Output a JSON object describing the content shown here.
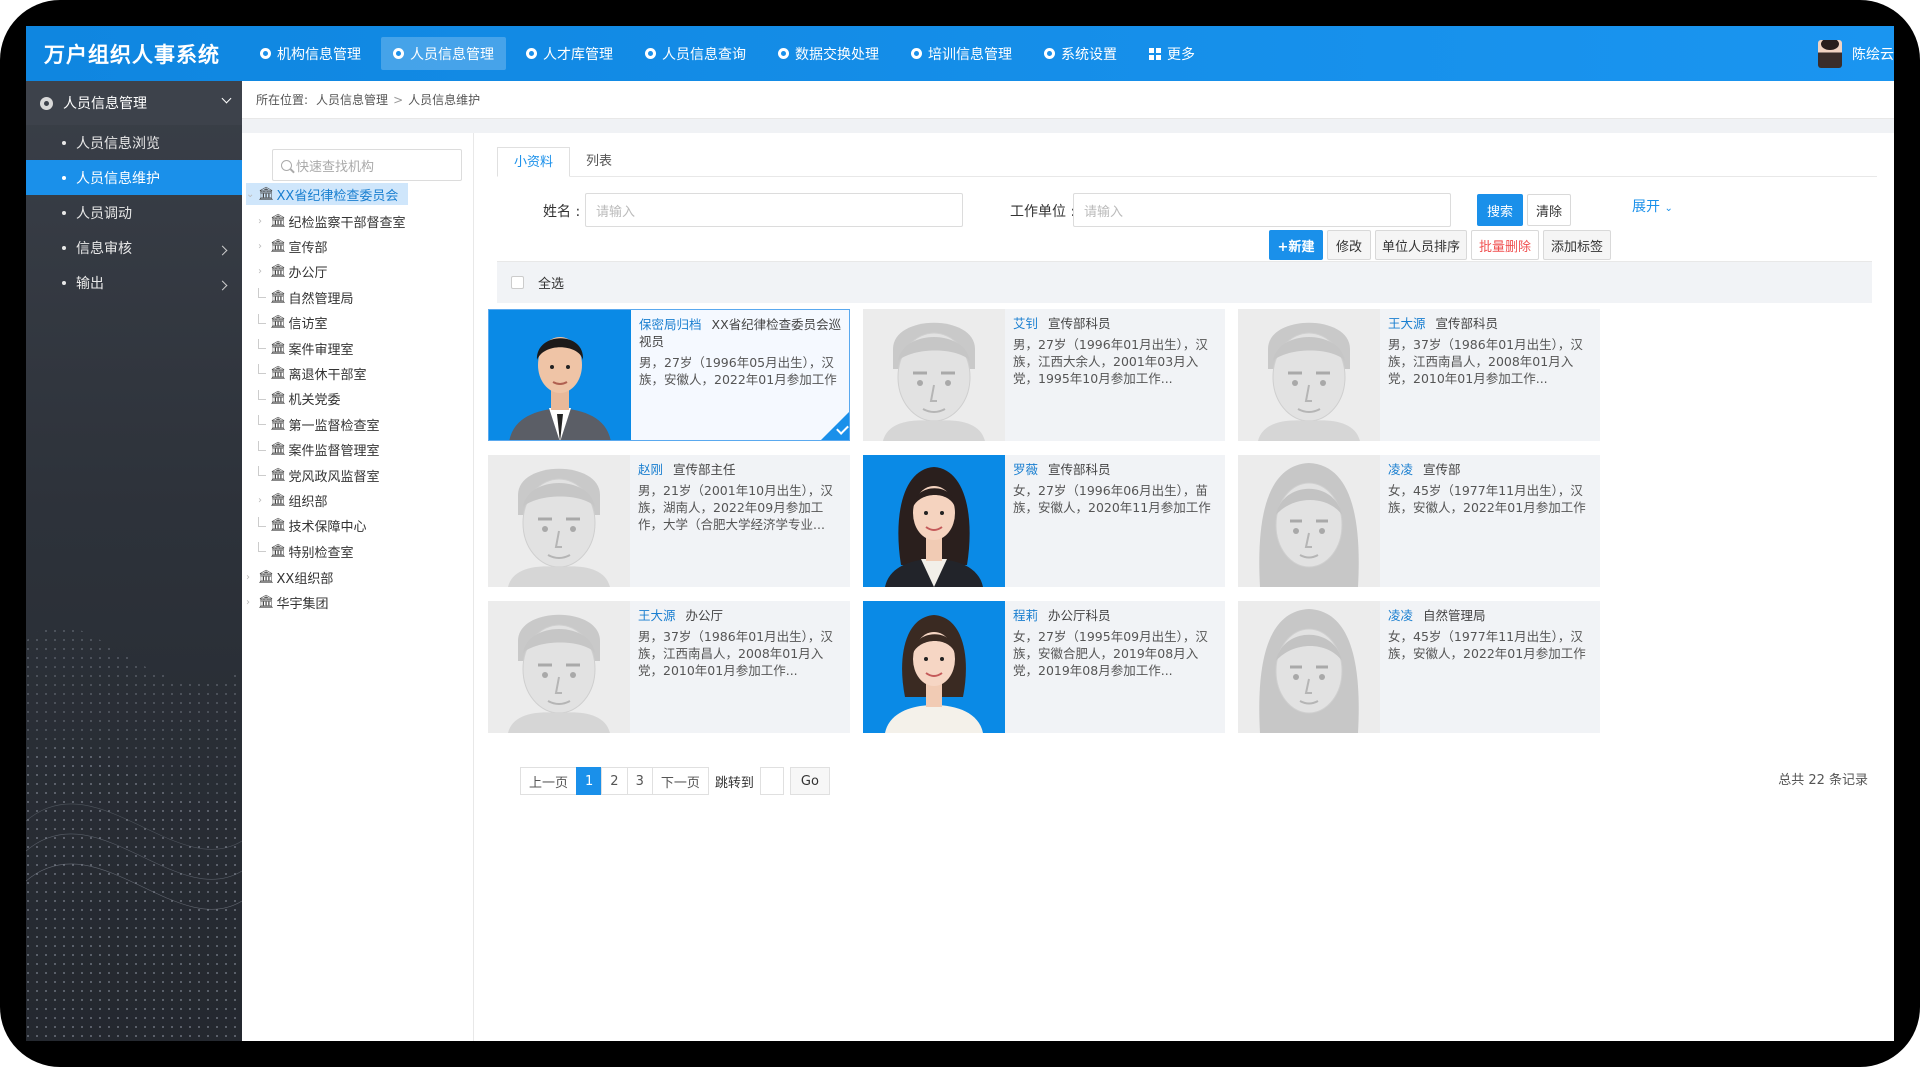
{
  "app": {
    "title": "万户组织人事系统"
  },
  "nav": [
    {
      "label": "机构信息管理",
      "icon": "circle-icon",
      "active": false
    },
    {
      "label": "人员信息管理",
      "icon": "circle-icon",
      "active": true
    },
    {
      "label": "人才库管理",
      "icon": "circle-icon",
      "active": false
    },
    {
      "label": "人员信息查询",
      "icon": "circle-icon",
      "active": false
    },
    {
      "label": "数据交换处理",
      "icon": "circle-icon",
      "active": false
    },
    {
      "label": "培训信息管理",
      "icon": "circle-icon",
      "active": false
    },
    {
      "label": "系统设置",
      "icon": "circle-icon",
      "active": false
    },
    {
      "label": "更多",
      "icon": "grid-icon",
      "active": false
    }
  ],
  "user": {
    "name": "陈绘云"
  },
  "sidebar": {
    "header": "人员信息管理",
    "items": [
      {
        "label": "人员信息浏览",
        "active": false,
        "has_children": false
      },
      {
        "label": "人员信息维护",
        "active": true,
        "has_children": false
      },
      {
        "label": "人员调动",
        "active": false,
        "has_children": false
      },
      {
        "label": "信息审核",
        "active": false,
        "has_children": true
      },
      {
        "label": "输出",
        "active": false,
        "has_children": true
      }
    ]
  },
  "breadcrumb": {
    "prefix": "所在位置:",
    "level1": "人员信息管理",
    "level2": "人员信息维护"
  },
  "tree": {
    "search_placeholder": "快速查找机构",
    "root": "XX省纪律检查委员会",
    "children": [
      "纪检监察干部督查室",
      "宣传部",
      "办公厅",
      "自然管理局",
      "信访室",
      "案件审理室",
      "离退休干部室",
      "机关党委",
      "第一监督检查室",
      "案件监督管理室",
      "党风政风监督室",
      "组织部",
      "技术保障中心",
      "特别检查室"
    ],
    "others": [
      "XX组织部",
      "华宇集团"
    ]
  },
  "tabs": [
    {
      "label": "小资料",
      "active": true
    },
    {
      "label": "列表",
      "active": false
    }
  ],
  "filters": {
    "name_label": "姓名 :",
    "name_placeholder": "请输入",
    "unit_label": "工作单位 :",
    "unit_placeholder": "请输入",
    "search": "搜索",
    "clear": "清除",
    "expand": "展开"
  },
  "toolbar": {
    "new": "+新建",
    "edit": "修改",
    "sort": "单位人员排序",
    "batch_delete": "批量删除",
    "add_tag": "添加标签"
  },
  "select_all": "全选",
  "cards": [
    {
      "name": "保密局归档",
      "dept": "XX省纪律检查委员会巡视员",
      "desc": "男，27岁（1996年05月出生），汉族，安徽人，2022年01月参加工作",
      "photo": "male-photo",
      "selected": true
    },
    {
      "name": "艾钊",
      "dept": "宣传部科员",
      "desc": "男，27岁（1996年01月出生），汉族，江西大余人，2001年03月入党，1995年10月参加工作...",
      "photo": "male-placeholder",
      "selected": false
    },
    {
      "name": "王大源",
      "dept": "宣传部科员",
      "desc": "男，37岁（1986年01月出生），汉族，江西南昌人，2008年01月入党，2010年01月参加工作...",
      "photo": "male-placeholder",
      "selected": false
    },
    {
      "name": "赵刚",
      "dept": "宣传部主任",
      "desc": "男，21岁（2001年10月出生），汉族，湖南人，2022年09月参加工作，大学（合肥大学经济学专业...",
      "photo": "male-placeholder",
      "selected": false
    },
    {
      "name": "罗薇",
      "dept": "宣传部科员",
      "desc": "女，27岁（1996年06月出生），苗族，安徽人，2020年11月参加工作",
      "photo": "female-photo-1",
      "selected": false
    },
    {
      "name": "凌凌",
      "dept": "宣传部",
      "desc": "女，45岁（1977年11月出生），汉族，安徽人，2022年01月参加工作",
      "photo": "female-placeholder",
      "selected": false
    },
    {
      "name": "王大源",
      "dept": "办公厅",
      "desc": "男，37岁（1986年01月出生），汉族，江西南昌人，2008年01月入党，2010年01月参加工作...",
      "photo": "male-placeholder",
      "selected": false
    },
    {
      "name": "程莉",
      "dept": "办公厅科员",
      "desc": "女，27岁（1995年09月出生），汉族，安徽合肥人，2019年08月入党，2019年08月参加工作...",
      "photo": "female-photo-2",
      "selected": false
    },
    {
      "name": "凌凌",
      "dept": "自然管理局",
      "desc": "女，45岁（1977年11月出生），汉族，安徽人，2022年01月参加工作",
      "photo": "female-placeholder",
      "selected": false
    }
  ],
  "pager": {
    "prev": "上一页",
    "pages": [
      "1",
      "2",
      "3"
    ],
    "current": "1",
    "next": "下一页",
    "jump": "跳转到",
    "go": "Go",
    "total": "总共 22 条记录"
  },
  "colors": {
    "primary": "#1a90ea",
    "sidebar_bg": "#2d323a",
    "danger": "#f05050",
    "photo_bg": "#0a8ae6"
  }
}
